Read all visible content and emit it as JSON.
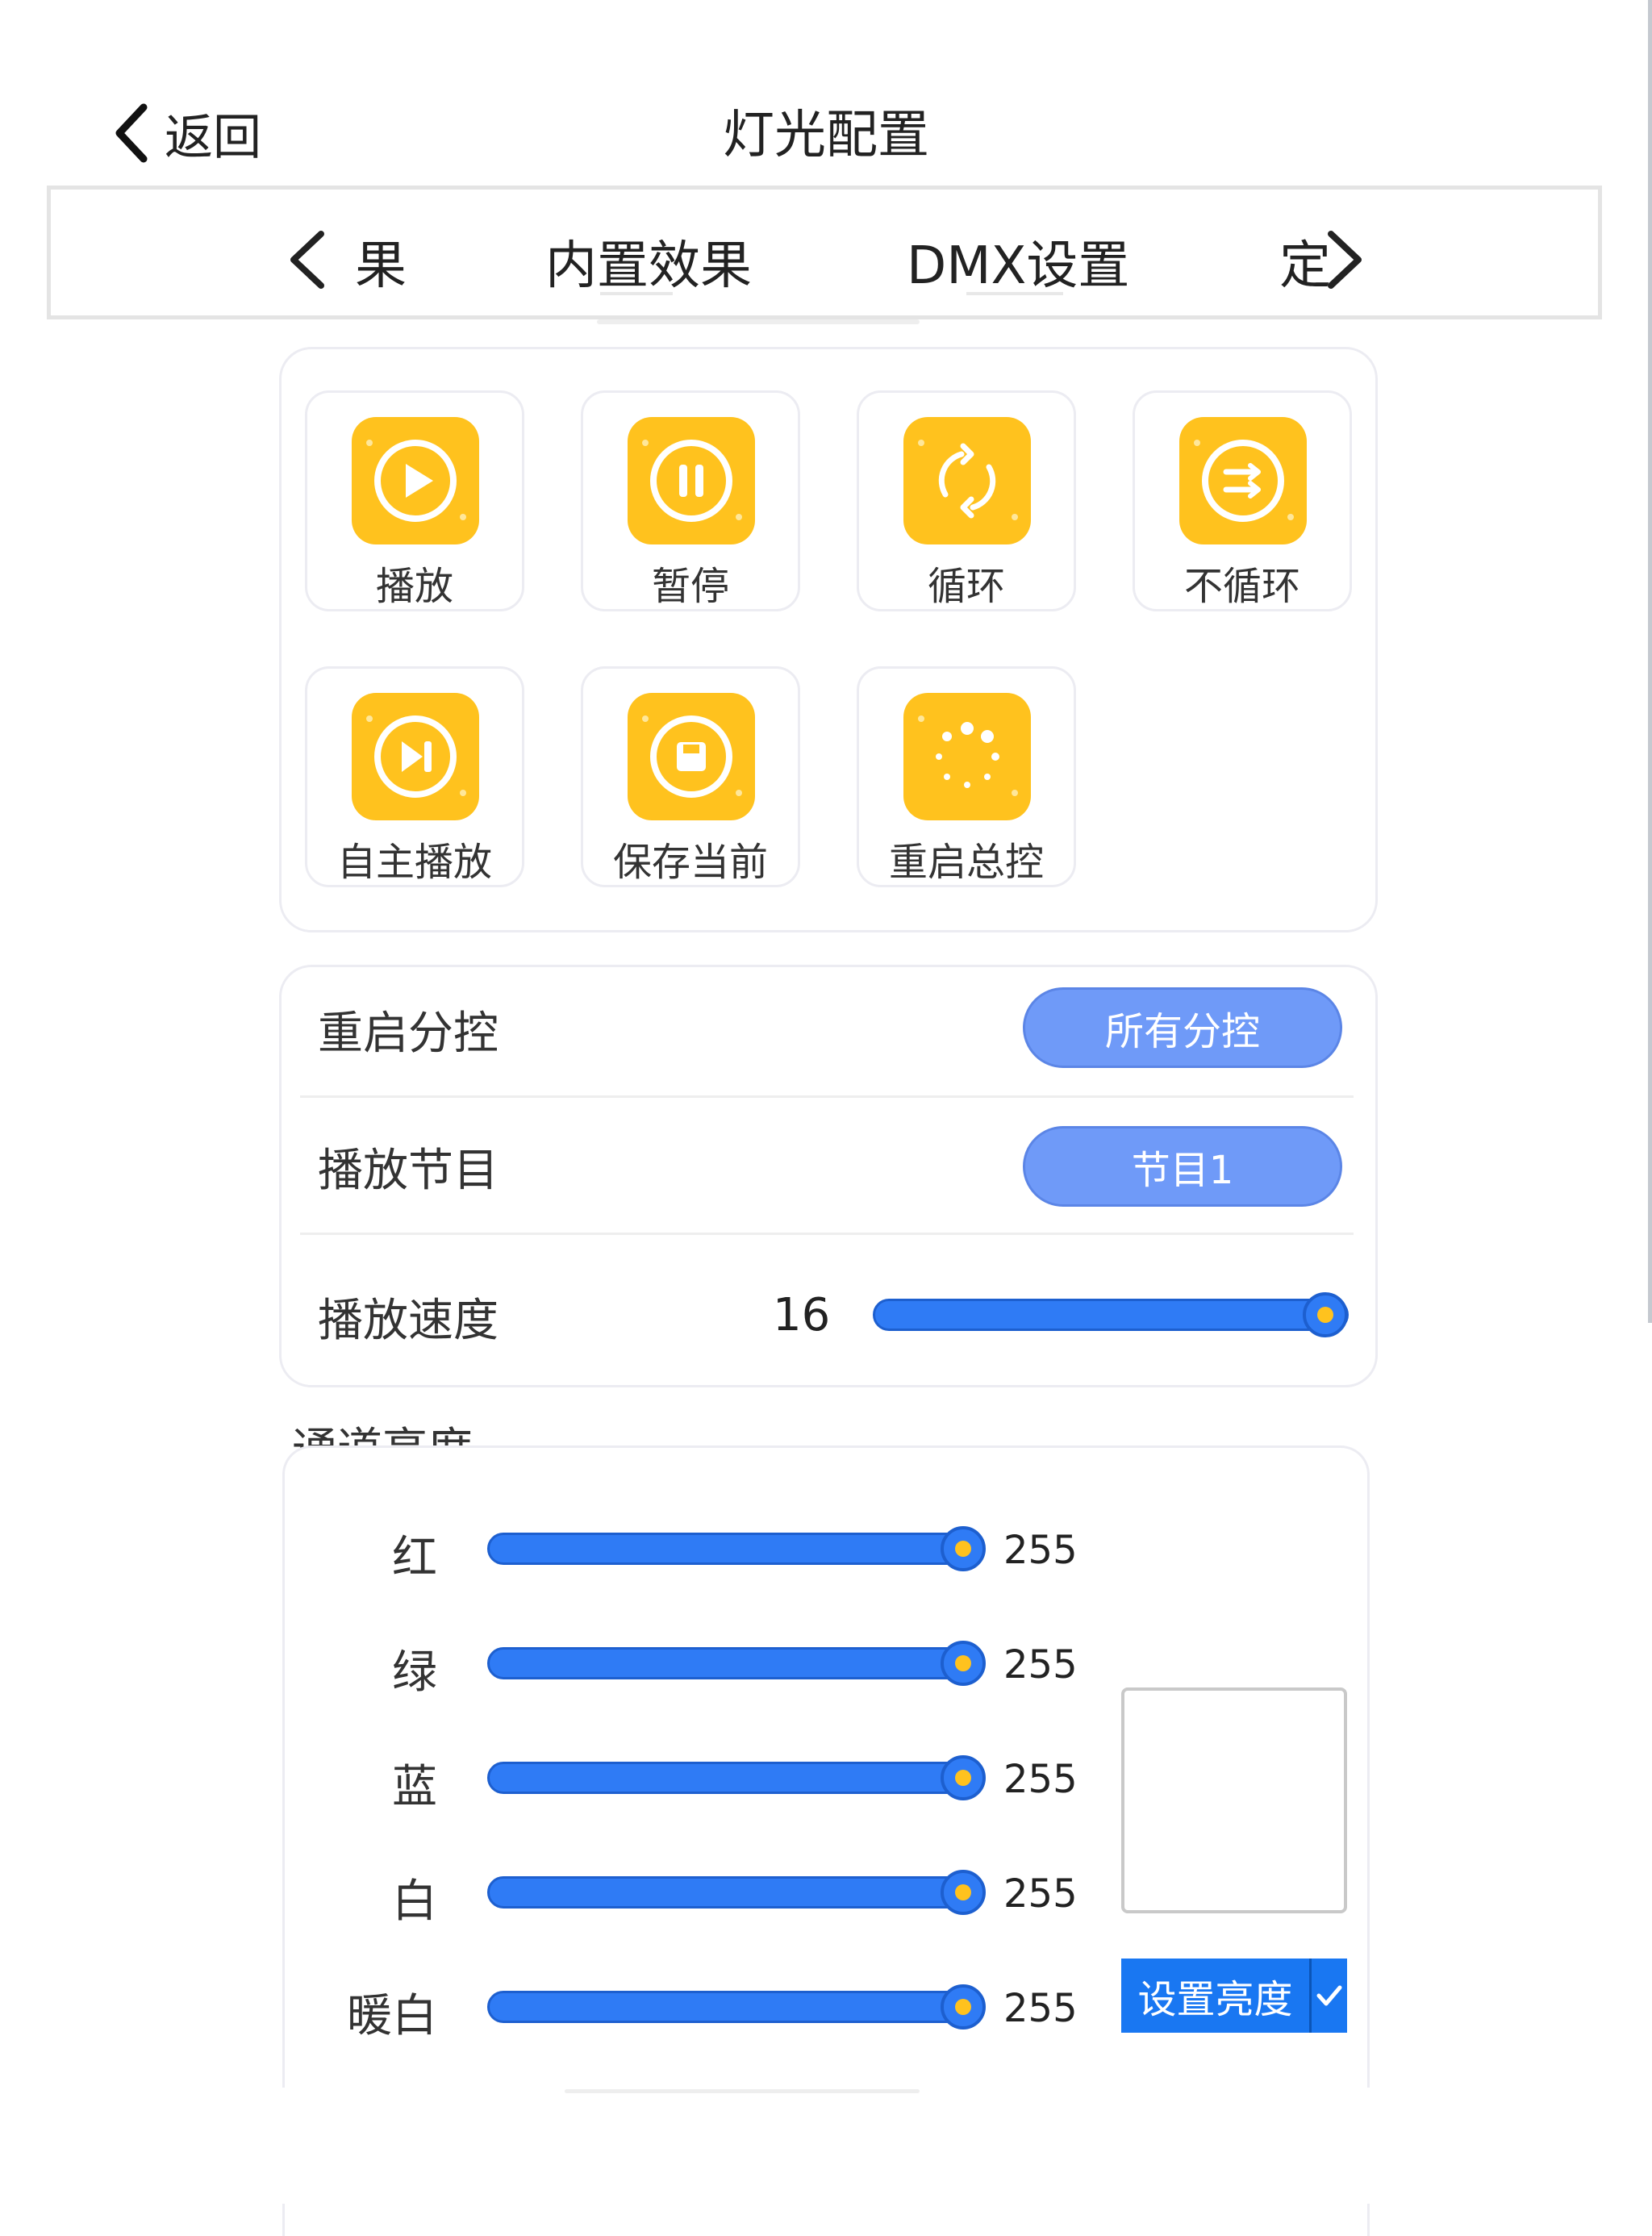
{
  "header": {
    "back_label": "返回",
    "title": "灯光配置"
  },
  "tabs": [
    {
      "label": "果"
    },
    {
      "label": "内置效果"
    },
    {
      "label": "DMX设置"
    },
    {
      "label": "定"
    }
  ],
  "actions": [
    {
      "label": "播放",
      "icon": "play-icon"
    },
    {
      "label": "暂停",
      "icon": "pause-icon"
    },
    {
      "label": "循环",
      "icon": "loop-icon"
    },
    {
      "label": "不循环",
      "icon": "no-loop-icon"
    },
    {
      "label": "自主播放",
      "icon": "skip-play-icon"
    },
    {
      "label": "保存当前",
      "icon": "save-icon"
    },
    {
      "label": "重启总控",
      "icon": "restart-spinner-icon"
    }
  ],
  "settings": {
    "restart_sub": {
      "label": "重启分控",
      "value": "所有分控"
    },
    "play_program": {
      "label": "播放节目",
      "value": "节目1"
    },
    "play_speed": {
      "label": "播放速度",
      "value": "16",
      "fraction": 1.0
    }
  },
  "brightness": {
    "section_title": "通道亮度",
    "channels": [
      {
        "label": "红",
        "value": "255",
        "fraction": 1.0
      },
      {
        "label": "绿",
        "value": "255",
        "fraction": 1.0
      },
      {
        "label": "蓝",
        "value": "255",
        "fraction": 1.0
      },
      {
        "label": "白",
        "value": "255",
        "fraction": 1.0
      },
      {
        "label": "暖白",
        "value": "255",
        "fraction": 1.0
      }
    ],
    "set_button": "设置亮度"
  },
  "colors": {
    "accent_blue": "#2f7bf5",
    "icon_yellow": "#ffc21e",
    "pill_blue": "#6f9af8"
  }
}
